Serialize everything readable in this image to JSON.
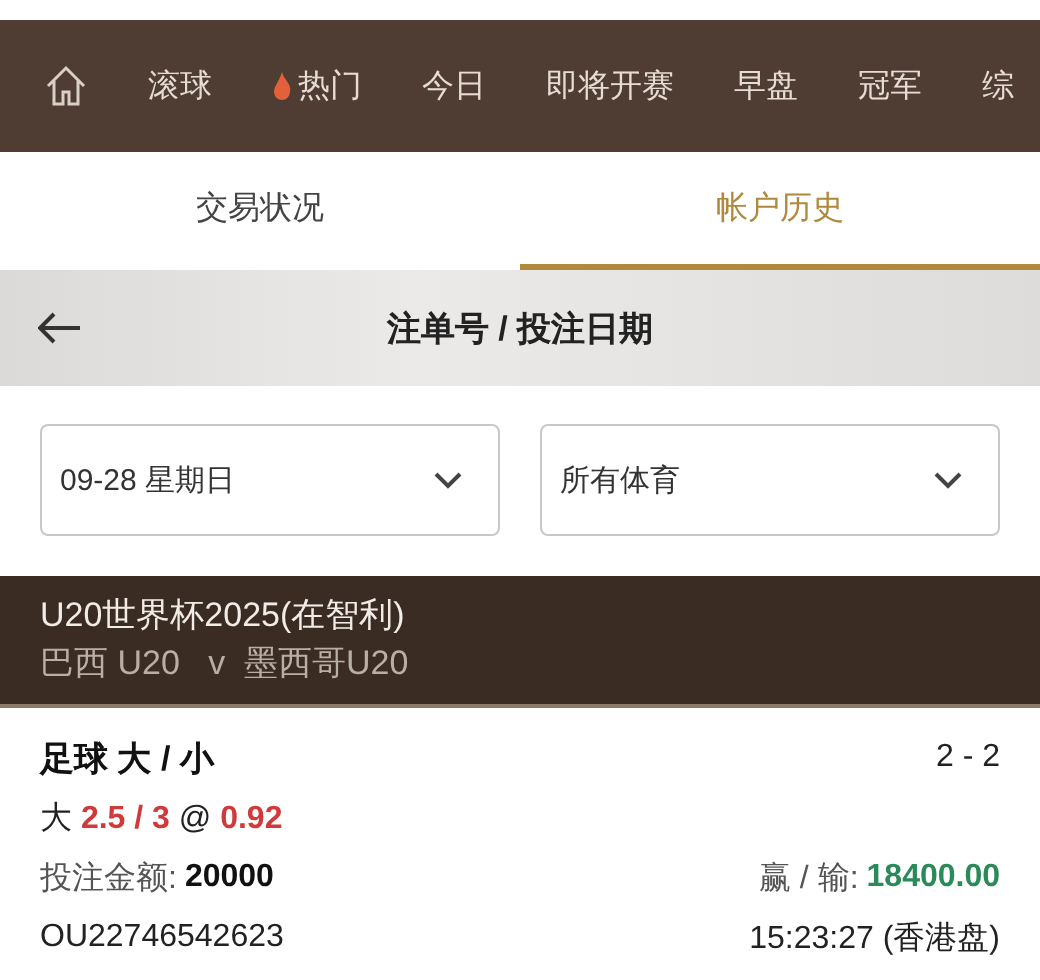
{
  "nav": {
    "items": [
      {
        "label": "滚球",
        "kind": "plain"
      },
      {
        "label": "热门",
        "kind": "hot"
      },
      {
        "label": "今日",
        "kind": "plain"
      },
      {
        "label": "即将开赛",
        "kind": "plain"
      },
      {
        "label": "早盘",
        "kind": "plain"
      },
      {
        "label": "冠军",
        "kind": "plain"
      },
      {
        "label": "综",
        "kind": "plain"
      }
    ]
  },
  "tabs": [
    {
      "label": "交易状况",
      "selected": false
    },
    {
      "label": "帐户历史",
      "selected": true
    }
  ],
  "header": {
    "title": "注单号 / 投注日期"
  },
  "filters": [
    {
      "value": "09-28 星期日"
    },
    {
      "value": "所有体育"
    }
  ],
  "match": {
    "league": "U20世界杯2025(在智利)",
    "teams": "巴西 U20   v  墨西哥U20"
  },
  "bet": {
    "title": "足球 大 / 小",
    "score": "2 - 2",
    "selection": "大 **2.5 / 3** @ **0.92**",
    "stake_label": "投注金额:",
    "stake": "20000",
    "result_label": "赢 / 输:",
    "result": "18400.00",
    "ref": "OU22746542623",
    "time": "15:23:27 (香港盘)"
  }
}
